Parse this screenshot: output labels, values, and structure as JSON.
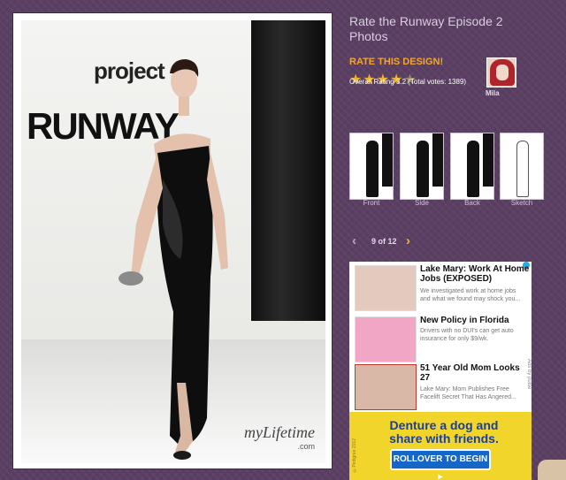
{
  "gallery": {
    "title": "Rate the Runway Episode 2 Photos",
    "rate_label": "RATE THIS DESIGN!",
    "stars_filled": "★★★★",
    "stars_empty": "★",
    "rating_text": "Overall Rating 3.2 (Total votes: 1389)",
    "judge_name": "Mila"
  },
  "photo": {
    "show_logo_line1": "project",
    "show_logo_line2": "RUNWAY",
    "network_watermark": "myLifetime",
    "network_watermark_sub": ".com"
  },
  "thumbnails": [
    {
      "label": "Front"
    },
    {
      "label": "Side"
    },
    {
      "label": "Back"
    },
    {
      "label": "Sketch"
    }
  ],
  "pager": {
    "prev": "‹",
    "count": "9 of 12",
    "next": "›"
  },
  "ad": {
    "items": [
      {
        "headline": "Lake Mary: Work At Home Jobs (EXPOSED)",
        "body": "We investigated work at home jobs and what we found may shock you..."
      },
      {
        "headline": "New Policy in Florida",
        "body": "Drivers with no DUI's can get auto insurance for only $9/wk."
      },
      {
        "headline": "51 Year Old Mom Looks 27",
        "body": "Lake Mary: Mom Publishes Free Facelift Secret That Has Angered..."
      }
    ],
    "ads_by": "Ads by pulse"
  },
  "banner": {
    "title": "Denture a dog and share with friends.",
    "button": "ROLLOVER TO BEGIN ▸",
    "copyright": "©Pedigree 2012"
  },
  "colors": {
    "background": "#5b3f63",
    "accent": "#f3a52b",
    "star": "#f2b42a"
  }
}
